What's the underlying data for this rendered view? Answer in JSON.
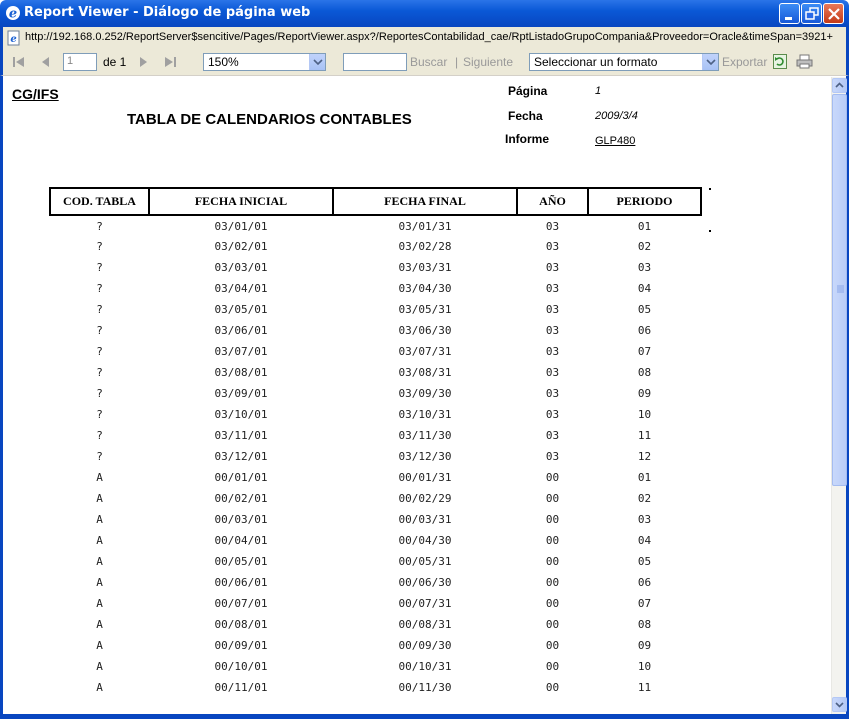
{
  "window": {
    "title": "Report Viewer - Diálogo de página web",
    "url": "http://192.168.0.252/ReportServer$sencitive/Pages/ReportViewer.aspx?/ReportesContabilidad_cae/RptListadoGrupoCompania&Proveedor=Oracle&timeSpan=3921+"
  },
  "toolbar": {
    "page_value": "1",
    "page_of": "de 1",
    "zoom": "150%",
    "search_placeholder": "",
    "find_label": "Buscar",
    "separator": "|",
    "next_label": "Siguiente",
    "format_select": "Seleccionar un formato",
    "export_label": "Exportar"
  },
  "report": {
    "company": "CG/IFS",
    "title": "TABLA DE CALENDARIOS CONTABLES",
    "page_label": "Página",
    "page_value": "1",
    "date_label": "Fecha",
    "date_value": "2009/3/4",
    "report_label": "Informe",
    "report_value": "GLP480",
    "columns": [
      "COD. TABLA",
      "FECHA INICIAL",
      "FECHA FINAL",
      "AÑO",
      "PERIODO"
    ],
    "rows": [
      [
        "?",
        "03/01/01",
        "03/01/31",
        "03",
        "01"
      ],
      [
        "?",
        "03/02/01",
        "03/02/28",
        "03",
        "02"
      ],
      [
        "?",
        "03/03/01",
        "03/03/31",
        "03",
        "03"
      ],
      [
        "?",
        "03/04/01",
        "03/04/30",
        "03",
        "04"
      ],
      [
        "?",
        "03/05/01",
        "03/05/31",
        "03",
        "05"
      ],
      [
        "?",
        "03/06/01",
        "03/06/30",
        "03",
        "06"
      ],
      [
        "?",
        "03/07/01",
        "03/07/31",
        "03",
        "07"
      ],
      [
        "?",
        "03/08/01",
        "03/08/31",
        "03",
        "08"
      ],
      [
        "?",
        "03/09/01",
        "03/09/30",
        "03",
        "09"
      ],
      [
        "?",
        "03/10/01",
        "03/10/31",
        "03",
        "10"
      ],
      [
        "?",
        "03/11/01",
        "03/11/30",
        "03",
        "11"
      ],
      [
        "?",
        "03/12/01",
        "03/12/30",
        "03",
        "12"
      ],
      [
        "A",
        "00/01/01",
        "00/01/31",
        "00",
        "01"
      ],
      [
        "A",
        "00/02/01",
        "00/02/29",
        "00",
        "02"
      ],
      [
        "A",
        "00/03/01",
        "00/03/31",
        "00",
        "03"
      ],
      [
        "A",
        "00/04/01",
        "00/04/30",
        "00",
        "04"
      ],
      [
        "A",
        "00/05/01",
        "00/05/31",
        "00",
        "05"
      ],
      [
        "A",
        "00/06/01",
        "00/06/30",
        "00",
        "06"
      ],
      [
        "A",
        "00/07/01",
        "00/07/31",
        "00",
        "07"
      ],
      [
        "A",
        "00/08/01",
        "00/08/31",
        "00",
        "08"
      ],
      [
        "A",
        "00/09/01",
        "00/09/30",
        "00",
        "09"
      ],
      [
        "A",
        "00/10/01",
        "00/10/31",
        "00",
        "10"
      ],
      [
        "A",
        "00/11/01",
        "00/11/30",
        "00",
        "11"
      ]
    ]
  },
  "colors": {
    "titlebar": "#0a58d6",
    "chrome": "#ece9d8",
    "frame": "#0846c0"
  }
}
